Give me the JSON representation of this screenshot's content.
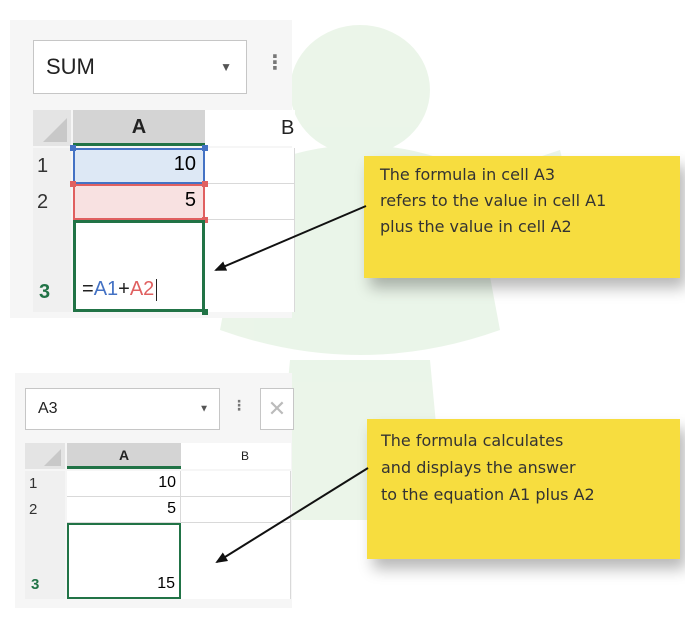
{
  "top_example": {
    "name_box": "SUM",
    "columns": [
      "A",
      "B"
    ],
    "rows": [
      "1",
      "2",
      "3"
    ],
    "cells": {
      "A1": "10",
      "A2": "5"
    },
    "formula": {
      "equals": "=",
      "ref1": "A1",
      "operator": "+",
      "ref2": "A2"
    },
    "callout_lines": [
      "The formula in cell A3",
      "refers to the value in cell A1",
      "plus the value in cell A2"
    ]
  },
  "bottom_example": {
    "name_box": "A3",
    "columns": [
      "A",
      "B"
    ],
    "rows": [
      "1",
      "2",
      "3"
    ],
    "cells": {
      "A1": "10",
      "A2": "5",
      "A3": "15"
    },
    "callout_lines": [
      "The formula calculates",
      "and displays the answer",
      "to the equation A1 plus A2"
    ]
  },
  "colors": {
    "excel_green": "#217346",
    "ref1_blue": "#4472c4",
    "ref2_red": "#e06060",
    "callout_yellow": "#f7dd3f"
  }
}
